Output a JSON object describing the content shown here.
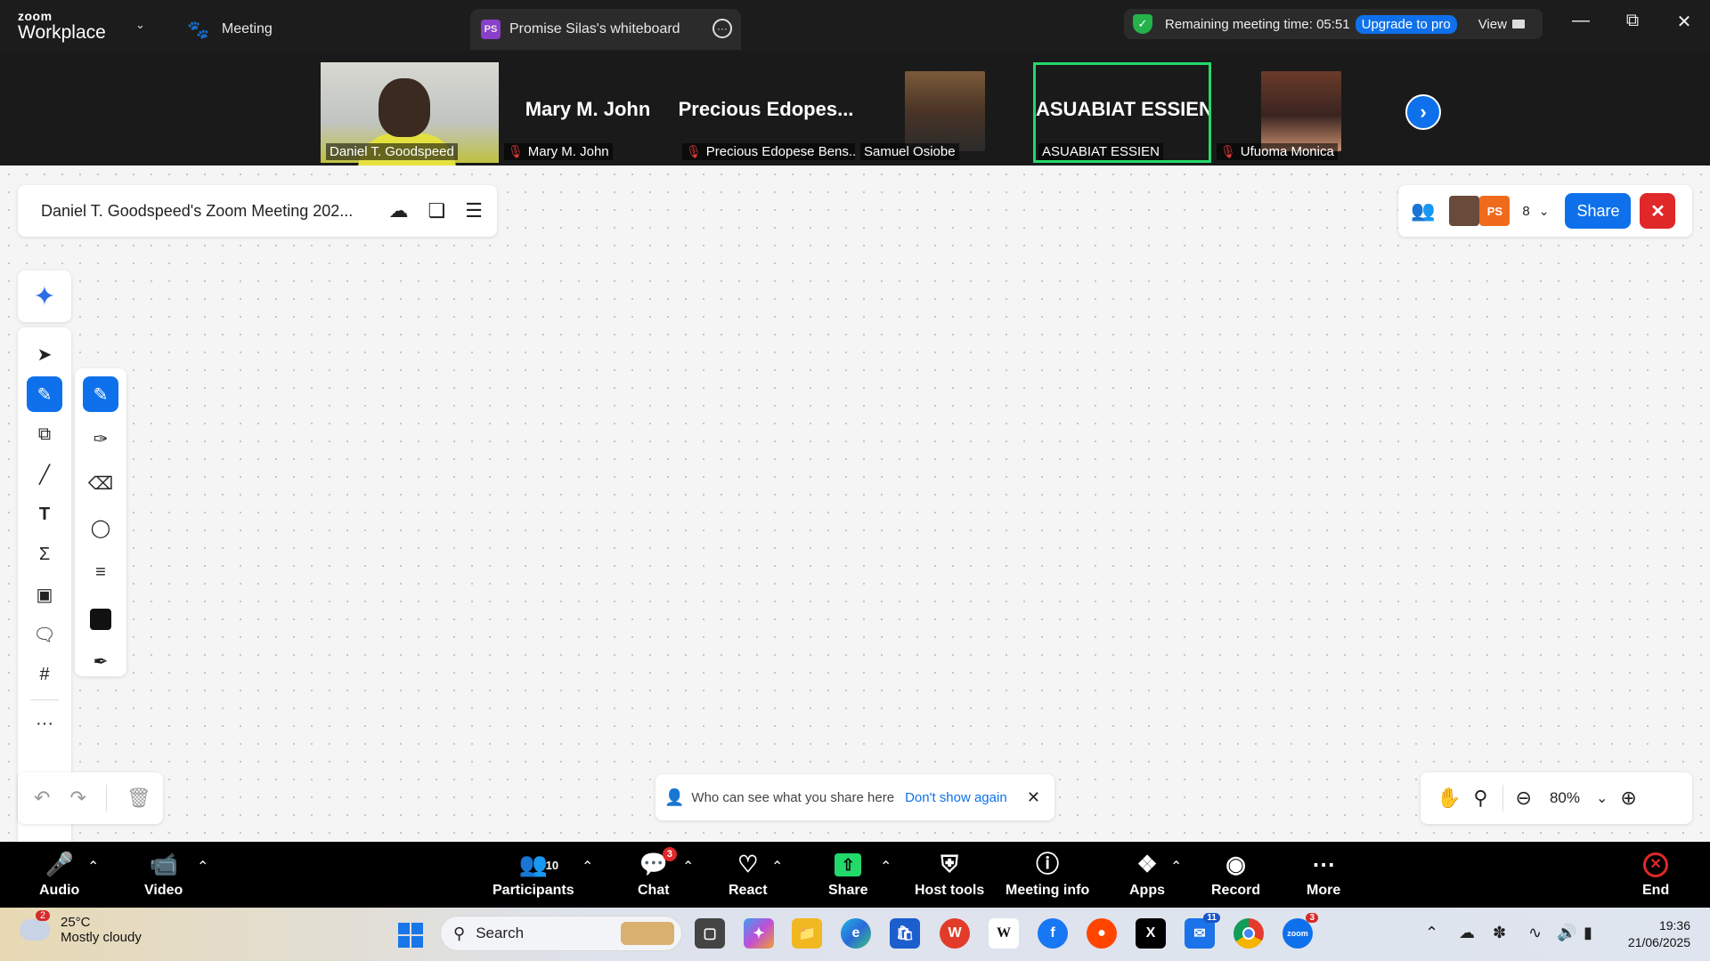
{
  "titlebar": {
    "logo_top": "zoom",
    "logo_bottom": "Workplace",
    "meeting_tab": "Meeting",
    "whiteboard_tab": {
      "badge": "PS",
      "title": "Promise Silas's whiteboard"
    },
    "remaining_label": "Remaining meeting time: 05:51",
    "upgrade_label": "Upgrade to pro",
    "view_label": "View"
  },
  "gallery": {
    "tiles": [
      {
        "label": "Daniel T. Goodspeed",
        "muted": false,
        "type": "video"
      },
      {
        "bigname": "Mary M. John",
        "label": "Mary M. John",
        "muted": true
      },
      {
        "bigname": "Precious  Edopes...",
        "label": "Precious Edopese Bens...",
        "muted": true
      },
      {
        "label": "Samuel Osiobe",
        "muted": false,
        "type": "photo"
      },
      {
        "bigname": "ASUABIAT ESSIEN",
        "label": "ASUABIAT ESSIEN",
        "muted": false,
        "active": true
      },
      {
        "label": "Ufuoma Monica",
        "muted": true,
        "type": "photo"
      }
    ]
  },
  "whiteboard": {
    "doc_title": "Daniel T. Goodspeed's Zoom Meeting 202...",
    "participants": {
      "avatar2": "PS",
      "count": "8"
    },
    "share_label": "Share",
    "notice": {
      "text": "Who can see what you share here",
      "link": "Don't show again"
    },
    "zoom_level": "80%"
  },
  "toolbar": {
    "audio": "Audio",
    "video": "Video",
    "participants": "Participants",
    "participants_count": "10",
    "chat": "Chat",
    "chat_badge": "3",
    "react": "React",
    "share": "Share",
    "host_tools": "Host tools",
    "meeting_info": "Meeting info",
    "apps": "Apps",
    "record": "Record",
    "more": "More",
    "end": "End"
  },
  "taskbar": {
    "weather_badge": "2",
    "temperature": "25°C",
    "condition": "Mostly cloudy",
    "search_placeholder": "Search",
    "teams_badge": "11",
    "zoom_badge": "3",
    "time": "19:36",
    "date": "21/06/2025"
  },
  "colors": {
    "accent": "#0e71eb",
    "active_speaker": "#23d96b",
    "danger": "#e02828",
    "canvas": "#f5f5f5"
  }
}
